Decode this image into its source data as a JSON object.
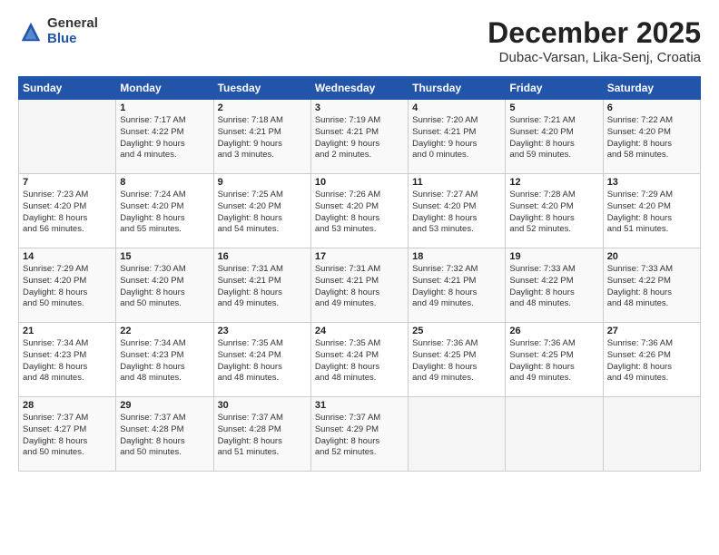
{
  "logo": {
    "general": "General",
    "blue": "Blue"
  },
  "header": {
    "month": "December 2025",
    "location": "Dubac-Varsan, Lika-Senj, Croatia"
  },
  "weekdays": [
    "Sunday",
    "Monday",
    "Tuesday",
    "Wednesday",
    "Thursday",
    "Friday",
    "Saturday"
  ],
  "weeks": [
    [
      {
        "day": "",
        "info": ""
      },
      {
        "day": "1",
        "info": "Sunrise: 7:17 AM\nSunset: 4:22 PM\nDaylight: 9 hours\nand 4 minutes."
      },
      {
        "day": "2",
        "info": "Sunrise: 7:18 AM\nSunset: 4:21 PM\nDaylight: 9 hours\nand 3 minutes."
      },
      {
        "day": "3",
        "info": "Sunrise: 7:19 AM\nSunset: 4:21 PM\nDaylight: 9 hours\nand 2 minutes."
      },
      {
        "day": "4",
        "info": "Sunrise: 7:20 AM\nSunset: 4:21 PM\nDaylight: 9 hours\nand 0 minutes."
      },
      {
        "day": "5",
        "info": "Sunrise: 7:21 AM\nSunset: 4:20 PM\nDaylight: 8 hours\nand 59 minutes."
      },
      {
        "day": "6",
        "info": "Sunrise: 7:22 AM\nSunset: 4:20 PM\nDaylight: 8 hours\nand 58 minutes."
      }
    ],
    [
      {
        "day": "7",
        "info": "Sunrise: 7:23 AM\nSunset: 4:20 PM\nDaylight: 8 hours\nand 56 minutes."
      },
      {
        "day": "8",
        "info": "Sunrise: 7:24 AM\nSunset: 4:20 PM\nDaylight: 8 hours\nand 55 minutes."
      },
      {
        "day": "9",
        "info": "Sunrise: 7:25 AM\nSunset: 4:20 PM\nDaylight: 8 hours\nand 54 minutes."
      },
      {
        "day": "10",
        "info": "Sunrise: 7:26 AM\nSunset: 4:20 PM\nDaylight: 8 hours\nand 53 minutes."
      },
      {
        "day": "11",
        "info": "Sunrise: 7:27 AM\nSunset: 4:20 PM\nDaylight: 8 hours\nand 53 minutes."
      },
      {
        "day": "12",
        "info": "Sunrise: 7:28 AM\nSunset: 4:20 PM\nDaylight: 8 hours\nand 52 minutes."
      },
      {
        "day": "13",
        "info": "Sunrise: 7:29 AM\nSunset: 4:20 PM\nDaylight: 8 hours\nand 51 minutes."
      }
    ],
    [
      {
        "day": "14",
        "info": "Sunrise: 7:29 AM\nSunset: 4:20 PM\nDaylight: 8 hours\nand 50 minutes."
      },
      {
        "day": "15",
        "info": "Sunrise: 7:30 AM\nSunset: 4:20 PM\nDaylight: 8 hours\nand 50 minutes."
      },
      {
        "day": "16",
        "info": "Sunrise: 7:31 AM\nSunset: 4:21 PM\nDaylight: 8 hours\nand 49 minutes."
      },
      {
        "day": "17",
        "info": "Sunrise: 7:31 AM\nSunset: 4:21 PM\nDaylight: 8 hours\nand 49 minutes."
      },
      {
        "day": "18",
        "info": "Sunrise: 7:32 AM\nSunset: 4:21 PM\nDaylight: 8 hours\nand 49 minutes."
      },
      {
        "day": "19",
        "info": "Sunrise: 7:33 AM\nSunset: 4:22 PM\nDaylight: 8 hours\nand 48 minutes."
      },
      {
        "day": "20",
        "info": "Sunrise: 7:33 AM\nSunset: 4:22 PM\nDaylight: 8 hours\nand 48 minutes."
      }
    ],
    [
      {
        "day": "21",
        "info": "Sunrise: 7:34 AM\nSunset: 4:23 PM\nDaylight: 8 hours\nand 48 minutes."
      },
      {
        "day": "22",
        "info": "Sunrise: 7:34 AM\nSunset: 4:23 PM\nDaylight: 8 hours\nand 48 minutes."
      },
      {
        "day": "23",
        "info": "Sunrise: 7:35 AM\nSunset: 4:24 PM\nDaylight: 8 hours\nand 48 minutes."
      },
      {
        "day": "24",
        "info": "Sunrise: 7:35 AM\nSunset: 4:24 PM\nDaylight: 8 hours\nand 48 minutes."
      },
      {
        "day": "25",
        "info": "Sunrise: 7:36 AM\nSunset: 4:25 PM\nDaylight: 8 hours\nand 49 minutes."
      },
      {
        "day": "26",
        "info": "Sunrise: 7:36 AM\nSunset: 4:25 PM\nDaylight: 8 hours\nand 49 minutes."
      },
      {
        "day": "27",
        "info": "Sunrise: 7:36 AM\nSunset: 4:26 PM\nDaylight: 8 hours\nand 49 minutes."
      }
    ],
    [
      {
        "day": "28",
        "info": "Sunrise: 7:37 AM\nSunset: 4:27 PM\nDaylight: 8 hours\nand 50 minutes."
      },
      {
        "day": "29",
        "info": "Sunrise: 7:37 AM\nSunset: 4:28 PM\nDaylight: 8 hours\nand 50 minutes."
      },
      {
        "day": "30",
        "info": "Sunrise: 7:37 AM\nSunset: 4:28 PM\nDaylight: 8 hours\nand 51 minutes."
      },
      {
        "day": "31",
        "info": "Sunrise: 7:37 AM\nSunset: 4:29 PM\nDaylight: 8 hours\nand 52 minutes."
      },
      {
        "day": "",
        "info": ""
      },
      {
        "day": "",
        "info": ""
      },
      {
        "day": "",
        "info": ""
      }
    ]
  ]
}
